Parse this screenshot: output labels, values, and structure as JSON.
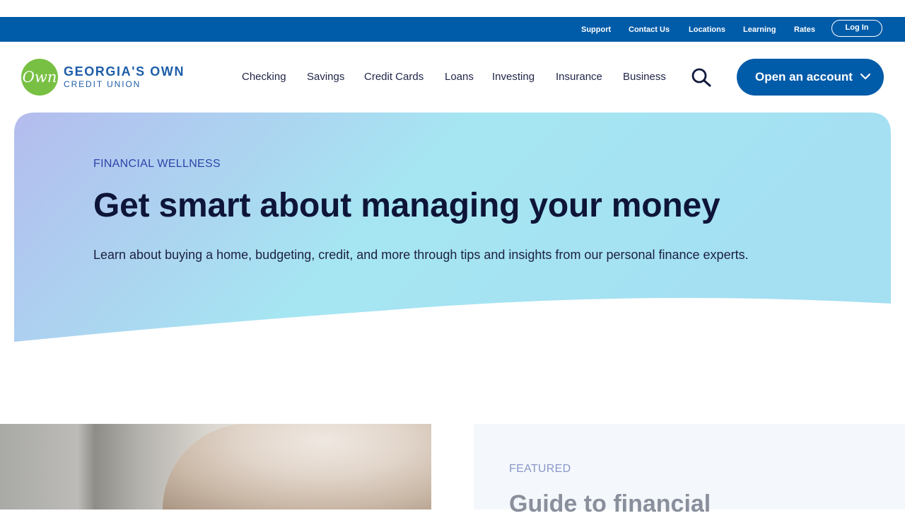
{
  "utility_nav": {
    "links": [
      "Support",
      "Contact Us",
      "Locations",
      "Learning",
      "Rates"
    ],
    "login_label": "Log In"
  },
  "logo": {
    "mark": "Own",
    "line1": "GEORGIA'S OWN",
    "line2": "CREDIT UNION"
  },
  "main_nav": {
    "items": [
      "Checking",
      "Savings",
      "Credit Cards",
      "Loans",
      "Investing",
      "Insurance",
      "Business"
    ],
    "search_icon": "search-icon",
    "cta_label": "Open an account"
  },
  "hero": {
    "eyebrow": "FINANCIAL WELLNESS",
    "title": "Get smart about managing your money",
    "subtitle": "Learn about buying a home, budgeting, credit, and more through tips and insights from our personal finance experts."
  },
  "featured": {
    "label": "FEATURED",
    "title": "Guide to financial"
  },
  "colors": {
    "brand_blue": "#005ba8",
    "logo_green": "#78c043",
    "hero_gradient_start": "#b4bcee",
    "hero_gradient_mid": "#a6e6f2"
  }
}
